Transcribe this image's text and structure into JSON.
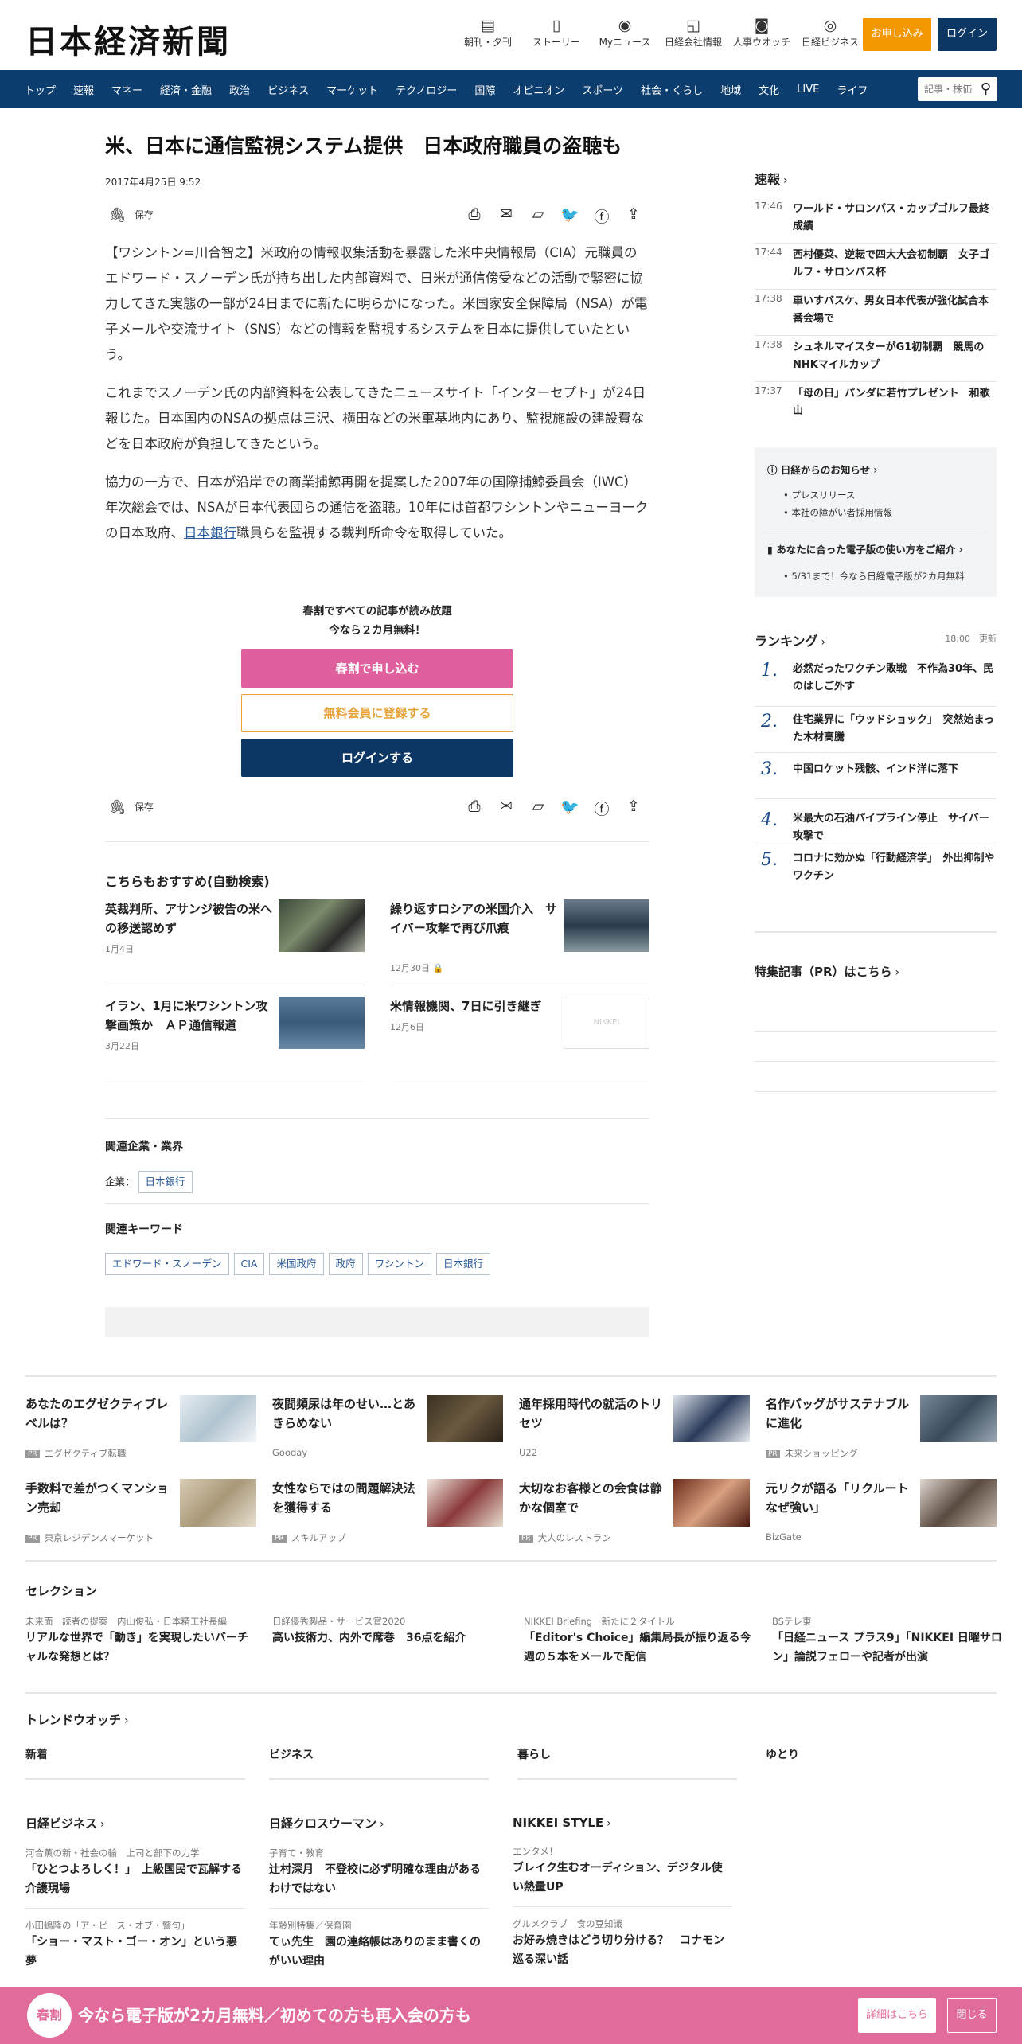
{
  "header": {
    "logo": "日本経済新聞",
    "nav": [
      {
        "label": "朝刊・夕刊",
        "icon": "newspaper-icon"
      },
      {
        "label": "ストーリー",
        "icon": "document-icon"
      },
      {
        "label": "Myニュース",
        "icon": "user-icon"
      },
      {
        "label": "日経会社情報",
        "icon": "chart-icon"
      },
      {
        "label": "人事ウオッチ",
        "icon": "search-person-icon"
      },
      {
        "label": "日経ビジネス",
        "icon": "compass-icon"
      }
    ],
    "subscribe": "お申し込み",
    "login": "ログイン"
  },
  "navbar": {
    "items": [
      "トップ",
      "速報",
      "マネー",
      "経済・金融",
      "政治",
      "ビジネス",
      "マーケット",
      "テクノロジー",
      "国際",
      "オピニオン",
      "スポーツ",
      "社会・くらし",
      "地域",
      "文化",
      "LIVE",
      "ライフ"
    ],
    "search_placeholder": "記事・株価"
  },
  "article": {
    "title": "米、日本に通信監視システム提供　日本政府職員の盗聴も",
    "date": "2017年4月25日 9:52",
    "save": "保存",
    "p1": "【ワシントン=川合智之】米政府の情報収集活動を暴露した米中央情報局（CIA）元職員のエドワード・スノーデン氏が持ち出した内部資料で、日米が通信傍受などの活動で緊密に協力してきた実態の一部が24日までに新たに明らかになった。米国家安全保障局（NSA）が電子メールや交流サイト（SNS）などの情報を監視するシステムを日本に提供していたという。",
    "p2": "これまでスノーデン氏の内部資料を公表してきたニュースサイト「インターセプト」が24日報じた。日本国内のNSAの拠点は三沢、横田などの米軍基地内にあり、監視施設の建設費などを日本政府が負担してきたという。",
    "p3a": "協力の一方で、日本が沿岸での商業捕鯨再開を提案した2007年の国際捕鯨委員会（IWC）年次総会では、NSAが日本代表団らの通信を盗聴。10年には首都ワシントンやニューヨークの日本政府、",
    "p3link": "日本銀行",
    "p3b": "職員らを監視する裁判所命令を取得していた。",
    "paywall_line1": "春割ですべての記事が読み放題",
    "paywall_line2": "今なら２カ月無料！",
    "btn_spring": "春割で申し込む",
    "btn_free": "無料会員に登録する",
    "btn_login": "ログインする"
  },
  "recommend": {
    "heading": "こちらもおすすめ(自動検索)",
    "items": [
      {
        "title": "英裁判所、アサンジ被告の米への移送認めず",
        "date": "1月4日"
      },
      {
        "title": "繰り返すロシアの米国介入　サイバー攻撃で再び爪痕",
        "date": "12月30日"
      },
      {
        "title": "イラン、1月に米ワシントン攻撃画策か　ＡＰ通信報道",
        "date": "3月22日"
      },
      {
        "title": "米情報機関、7日に引き継ぎ",
        "date": "12月6日",
        "thumb": "NIKKEI"
      }
    ]
  },
  "related": {
    "companies_heading": "関連企業・業界",
    "companies_label": "企業：",
    "company_tag": "日本銀行",
    "keywords_heading": "関連キーワード",
    "keywords": [
      "エドワード・スノーデン",
      "CIA",
      "米国政府",
      "政府",
      "ワシントン",
      "日本銀行"
    ]
  },
  "sidebar": {
    "breaking_heading": "速報",
    "breaking": [
      {
        "time": "17:46",
        "text": "ワールド・サロンパス・カップゴルフ最終成績"
      },
      {
        "time": "17:44",
        "text": "西村優菜、逆転で四大大会初制覇　女子ゴルフ・サロンパス杯"
      },
      {
        "time": "17:38",
        "text": "車いすバスケ、男女日本代表が強化試合本番会場で"
      },
      {
        "time": "17:38",
        "text": "シュネルマイスターがG1初制覇　競馬のNHKマイルカップ"
      },
      {
        "time": "17:37",
        "text": "「母の日」パンダに若竹プレゼント　和歌山"
      }
    ],
    "info_heading": "日経からのお知らせ",
    "info_items": [
      "プレスリリース",
      "本社の障がい者採用情報"
    ],
    "guide_heading": "あなたに合った電子版の使い方をご紹介",
    "guide_item": "5/31まで！今なら日経電子版が2カ月無料",
    "ranking_heading": "ランキング",
    "ranking_time": "18:00",
    "ranking_update": "更新",
    "ranking": [
      {
        "n": "1.",
        "text": "必然だったワクチン敗戦　不作為30年、民のはしご外す"
      },
      {
        "n": "2.",
        "text": "住宅業界に「ウッドショック」　突然始まった木材高騰"
      },
      {
        "n": "3.",
        "text": "中国ロケット残骸、インド洋に落下"
      },
      {
        "n": "4.",
        "text": "米最大の石油パイプライン停止　サイバー攻撃で"
      },
      {
        "n": "5.",
        "text": "コロナに効かぬ「行動経済学」　外出抑制やワクチン"
      }
    ],
    "pr_heading": "特集記事（PR）はこちら"
  },
  "ads": [
    {
      "title": "あなたのエグゼクティブレベルは？",
      "src": "エグゼクティブ転職",
      "pr": "PR"
    },
    {
      "title": "夜間頻尿は年のせい…とあきらめない",
      "src": "Gooday",
      "pr": ""
    },
    {
      "title": "通年採用時代の就活のトリセツ",
      "src": "U22",
      "pr": ""
    },
    {
      "title": "名作バッグがサステナブルに進化",
      "src": "未来ショッピング",
      "pr": "PR"
    },
    {
      "title": "手数料で差がつくマンション売却",
      "src": "東京レジデンスマーケット",
      "pr": "PR"
    },
    {
      "title": "女性ならではの問題解決法を獲得する",
      "src": "スキルアップ",
      "pr": "PR"
    },
    {
      "title": "大切なお客様との会食は静かな個室で",
      "src": "大人のレストラン",
      "pr": "PR"
    },
    {
      "title": "元リクが語る「リクルートなぜ強い」",
      "src": "BizGate",
      "pr": ""
    }
  ],
  "selection": {
    "heading": "セレクション",
    "items": [
      {
        "kicker": "未来面　読者の提案　内山俊弘・日本精工社長編",
        "title": "リアルな世界で「動き」を実現したいバーチャルな発想とは？"
      },
      {
        "kicker": "日経優秀製品・サービス賞2020",
        "title": "高い技術力、内外で席巻　36点を紹介"
      },
      {
        "kicker": "NIKKEI Briefing　新たに２タイトル",
        "title": "「Editor's Choice」編集局長が振り返る今週の５本をメールで配信"
      },
      {
        "kicker": "BSテレ東",
        "title": "「日経ニュース プラス9」「NIKKEI 日曜サロン」論説フェローや記者が出演"
      }
    ]
  },
  "trend": {
    "heading": "トレンドウオッチ",
    "cols": [
      "新着",
      "ビジネス",
      "暮らし",
      "ゆとり"
    ]
  },
  "mags": [
    {
      "heading": "日経ビジネス",
      "items": [
        {
          "kicker": "河合薫の新・社会の輪　上司と部下の力学",
          "title": "「ひとつよろしく！」　上級国民で瓦解する介護現場"
        },
        {
          "kicker": "小田嶋隆の「ア・ピース・オブ・警句」",
          "title": "「ショー・マスト・ゴー・オン」という悪夢"
        }
      ]
    },
    {
      "heading": "日経クロスウーマン",
      "items": [
        {
          "kicker": "子育て・教育",
          "title": "辻村深月　不登校に必ず明確な理由があるわけではない"
        },
        {
          "kicker": "年齢別特集／保育園",
          "title": "てぃ先生　園の連絡帳はありのまま書くのがいい理由"
        }
      ]
    },
    {
      "heading": "NIKKEI STYLE",
      "items": [
        {
          "kicker": "エンタメ！",
          "title": "ブレイク生むオーディション、デジタル使い熱量UP"
        },
        {
          "kicker": "グルメクラブ　食の豆知識",
          "title": "お好み焼きはどう切り分ける？　コナモン巡る深い話"
        }
      ]
    }
  ],
  "banner": {
    "badge": "春割",
    "message": "今なら電子版が2カ月無料／初めての方も再入会の方も",
    "details": "詳細はこちら",
    "close": "閉じる"
  }
}
